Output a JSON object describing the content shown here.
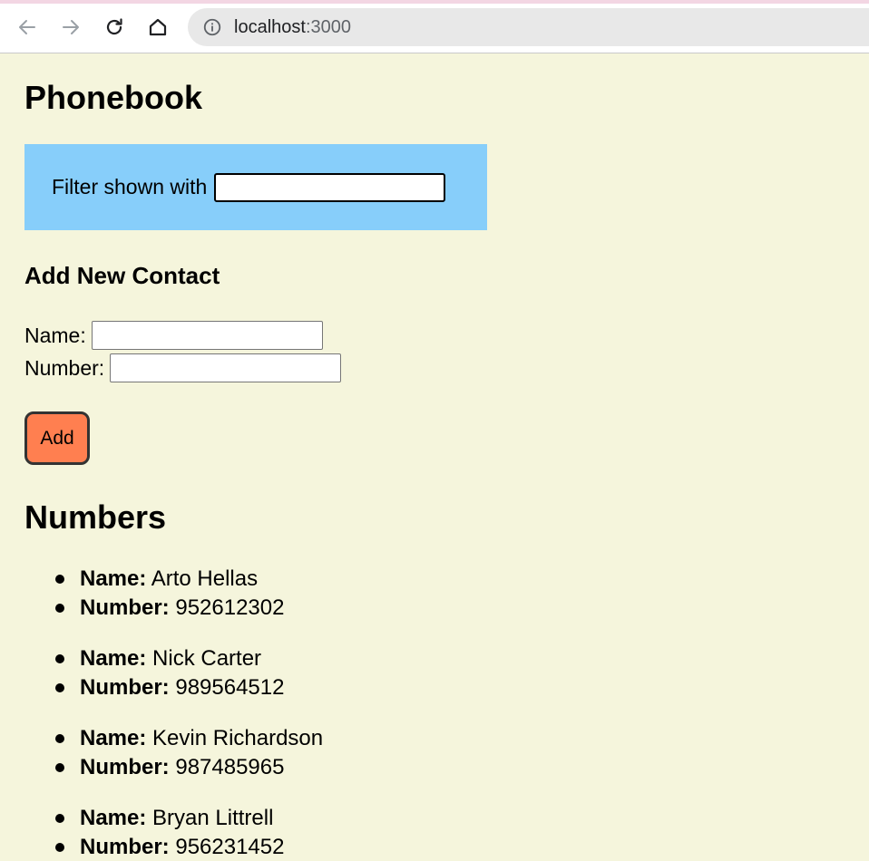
{
  "browser": {
    "url_host": "localhost",
    "url_port": ":3000",
    "icons": {
      "back": "arrow-left-icon",
      "forward": "arrow-right-icon",
      "reload": "reload-icon",
      "home": "home-icon",
      "info": "info-icon"
    }
  },
  "page": {
    "title": "Phonebook",
    "filter": {
      "label": "Filter shown with",
      "value": ""
    },
    "add_section": {
      "title": "Add New Contact",
      "name_label": "Name:",
      "name_value": "",
      "number_label": "Number:",
      "number_value": "",
      "add_button": "Add"
    },
    "numbers_section": {
      "title": "Numbers",
      "name_key": "Name:",
      "number_key": "Number:",
      "contacts": [
        {
          "name": "Arto Hellas",
          "number": "952612302"
        },
        {
          "name": "Nick Carter",
          "number": "989564512"
        },
        {
          "name": "Kevin Richardson",
          "number": "987485965"
        },
        {
          "name": "Bryan Littrell",
          "number": "956231452"
        }
      ]
    }
  },
  "colors": {
    "page_background": "#f5f5dc",
    "filter_background": "#87cefa",
    "add_button_background": "#ff7f50"
  }
}
